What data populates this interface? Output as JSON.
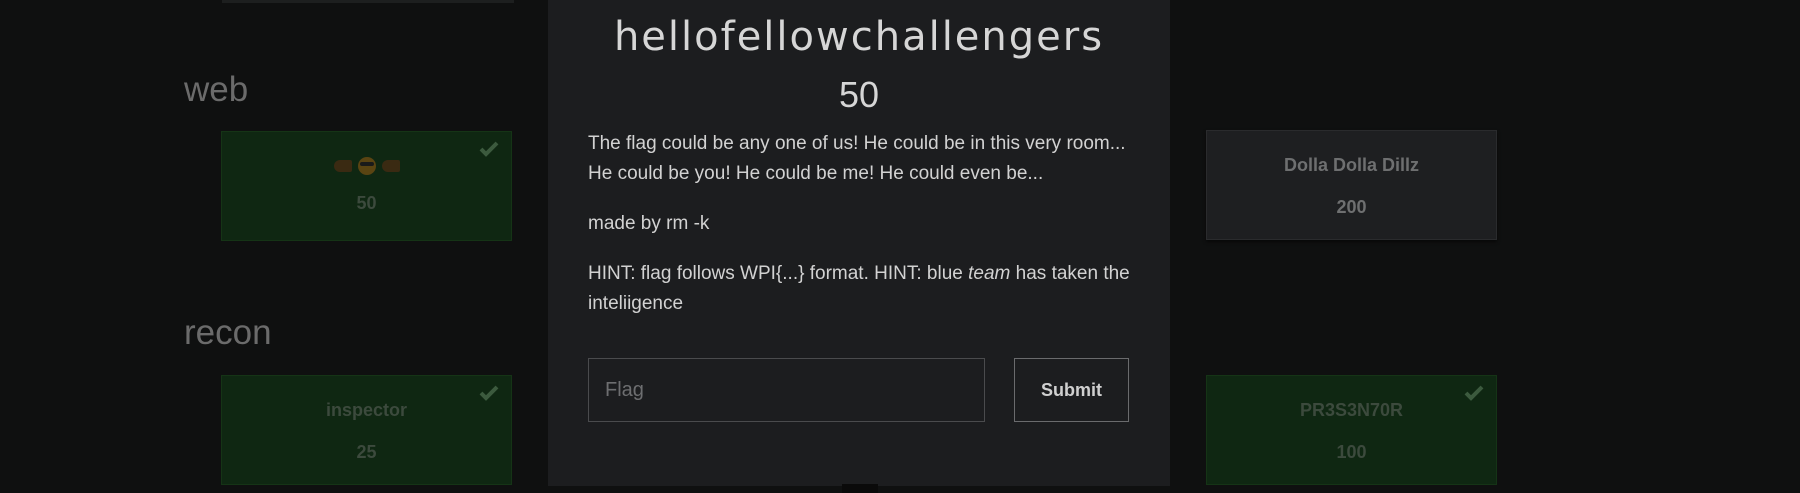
{
  "categories": {
    "web": "web",
    "recon": "recon"
  },
  "cards": [
    {
      "name": "",
      "emoji": "👉😎👉",
      "value": "50",
      "solved": true
    },
    {
      "name": "Dolla Dolla Dillz",
      "value": "200",
      "solved": false
    },
    {
      "name": "inspector",
      "value": "25",
      "solved": true
    },
    {
      "name": "PR3S3N70R",
      "value": "100",
      "solved": true
    }
  ],
  "modal": {
    "title": "hellofellowchallengers",
    "value": "50",
    "description_1": "The flag could be any one of us! He could be in this very room... He could be you! He could be me! He could even be...",
    "description_2": "made by rm -k",
    "hint_part1": "HINT: flag follows WPI{...} format. HINT: blue ",
    "hint_em": "team",
    "hint_part2": " has taken the inteliigence",
    "flag_placeholder": "Flag",
    "submit_label": "Submit"
  },
  "icons": {
    "solved": "check-icon"
  },
  "colors": {
    "solved_bg": "#0f2712",
    "unsolved_bg": "#1e1f21",
    "modal_bg": "#1c1d1f"
  }
}
